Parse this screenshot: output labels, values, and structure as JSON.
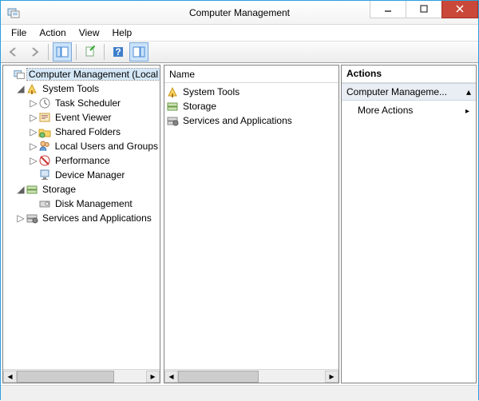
{
  "window": {
    "title": "Computer Management"
  },
  "menu": {
    "file": "File",
    "action": "Action",
    "view": "View",
    "help": "Help"
  },
  "tree": {
    "root": "Computer Management (Local",
    "system_tools": "System Tools",
    "task_scheduler": "Task Scheduler",
    "event_viewer": "Event Viewer",
    "shared_folders": "Shared Folders",
    "local_users": "Local Users and Groups",
    "performance": "Performance",
    "device_manager": "Device Manager",
    "storage": "Storage",
    "disk_management": "Disk Management",
    "services_apps": "Services and Applications"
  },
  "list": {
    "header": "Name",
    "items": {
      "system_tools": "System Tools",
      "storage": "Storage",
      "services_apps": "Services and Applications"
    }
  },
  "actions": {
    "header": "Actions",
    "selected": "Computer Manageme...",
    "more": "More Actions"
  }
}
